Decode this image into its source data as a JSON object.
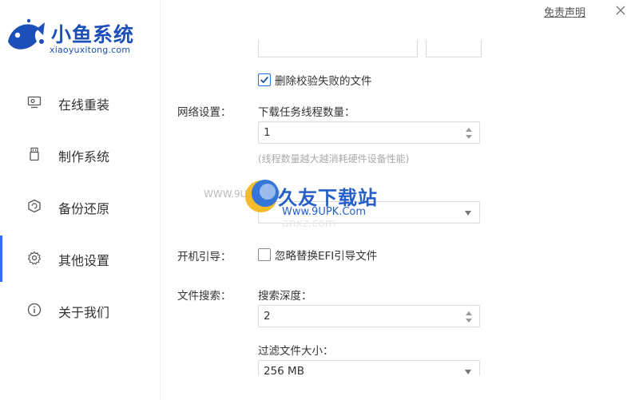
{
  "brand": {
    "name": "小鱼系统",
    "domain": "xiaoyuxitong.com",
    "color": "#1d4fb8"
  },
  "header": {
    "disclaimer": "免责声明"
  },
  "sidebar": {
    "items": [
      {
        "label": "在线重装",
        "icon": "monitor-icon"
      },
      {
        "label": "制作系统",
        "icon": "usb-icon"
      },
      {
        "label": "备份还原",
        "icon": "backup-icon"
      },
      {
        "label": "其他设置",
        "icon": "gear-icon",
        "active": true
      },
      {
        "label": "关于我们",
        "icon": "info-icon"
      }
    ]
  },
  "settings": {
    "delete_failed": {
      "label": "删除校验失败的文件",
      "checked": true
    },
    "network": {
      "section": "网络设置：",
      "threads_label": "下载任务线程数量：",
      "threads_value": "1",
      "threads_hint": "(线程数量越大越消耗硬件设备性能)"
    },
    "boot": {
      "section": "开机引导：",
      "ignore_efi": {
        "label": "忽略替换EFI引导文件",
        "checked": false
      }
    },
    "file_search": {
      "section": "文件搜索：",
      "depth_label": "搜索深度：",
      "depth_value": "2",
      "filter_label": "过滤文件大小：",
      "filter_value": "256 MB"
    }
  },
  "watermark": {
    "left": "WWW.9UPK.COM",
    "main": "久友下载站",
    "url": "Www.9UPK.Com",
    "faded": "anxz.com"
  },
  "colors": {
    "accent": "#2d6df6"
  }
}
